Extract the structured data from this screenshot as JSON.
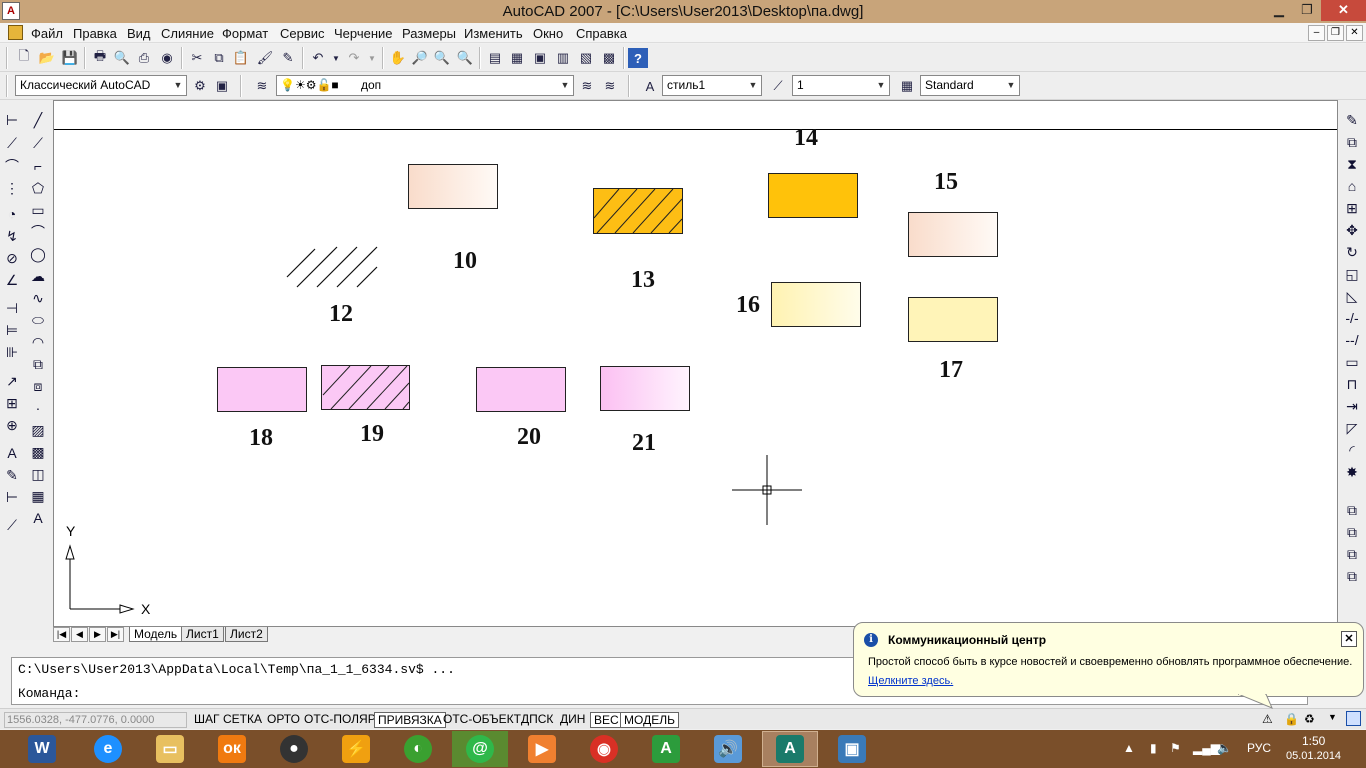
{
  "window": {
    "title": "AutoCAD 2007 - [C:\\Users\\User2013\\Desktop\\па.dwg]",
    "app_icon": "autocad-icon",
    "controls": [
      "▁",
      "❐",
      "✕"
    ]
  },
  "menu": {
    "items": [
      "Файл",
      "Правка",
      "Вид",
      "Слияние",
      "Формат",
      "Сервис",
      "Черчение",
      "Размеры",
      "Изменить",
      "Окно",
      "Справка"
    ],
    "mdi_controls": [
      "–",
      "❐",
      "✕"
    ]
  },
  "toolbar2": {
    "workspace": "Классический AutoCAD",
    "layer": "доп",
    "text_style": "стиль1",
    "dim_style": "1",
    "table_style": "Standard"
  },
  "drawing": {
    "labels": [
      "10",
      "12",
      "13",
      "14",
      "15",
      "16",
      "17",
      "18",
      "19",
      "20",
      "21"
    ],
    "ucs_x": "X",
    "ucs_y": "Y"
  },
  "tabs": {
    "items": [
      "Модель",
      "Лист1",
      "Лист2"
    ],
    "nav": [
      "|◀",
      "◀",
      "▶",
      "▶|"
    ]
  },
  "command": {
    "history": "C:\\Users\\User2013\\AppData\\Local\\Temp\\па_1_1_6334.sv$ ...",
    "prompt": "Команда:"
  },
  "status": {
    "coords": "1556.0328, -477.0776, 0.0000",
    "buttons": [
      "ШАГ",
      "СЕТКА",
      "ОРТО",
      "ОТС-ПОЛЯР",
      "ПРИВЯЗКА",
      "ОТС-ОБЪЕКТ",
      "ДПСК",
      "ДИН",
      "ВЕС",
      "МОДЕЛЬ"
    ]
  },
  "balloon": {
    "title": "Коммуникационный центр",
    "text": "Простой способ быть в курсе новостей и своевременно обновлять программное обеспечение.",
    "link": "Щелкните здесь.",
    "close": "✕"
  },
  "taskbar": {
    "time": "1:50",
    "date": "05.01.2014",
    "lang": "РУС"
  },
  "colors": {
    "titlebar": "#c8a47a",
    "taskbar": "#7a4f2a",
    "peach": "#fbe6da",
    "orange": "#ffc000",
    "pale_yellow": "#fff2b0",
    "pink": "#fbc8f4"
  }
}
